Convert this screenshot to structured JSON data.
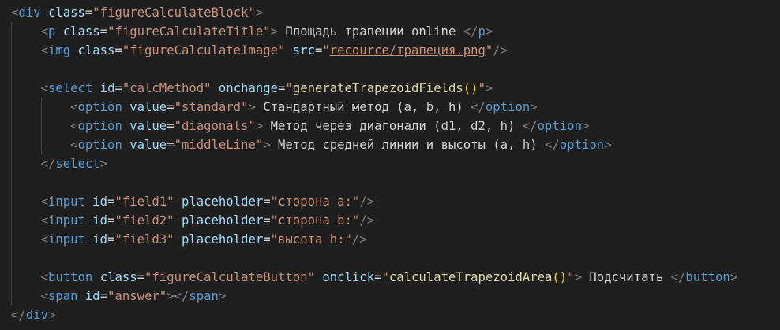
{
  "editor": {
    "lines": [
      {
        "indent": "",
        "parts": [
          {
            "c": "br",
            "t": "<"
          },
          {
            "c": "tag",
            "t": "div"
          },
          {
            "c": "txt",
            "t": " "
          },
          {
            "c": "attr",
            "t": "class"
          },
          {
            "c": "eq",
            "t": "="
          },
          {
            "c": "str",
            "t": "\"figureCalculateBlock\""
          },
          {
            "c": "br",
            "t": ">"
          }
        ]
      },
      {
        "indent": "    ",
        "parts": [
          {
            "c": "br",
            "t": "<"
          },
          {
            "c": "tag",
            "t": "p"
          },
          {
            "c": "txt",
            "t": " "
          },
          {
            "c": "attr",
            "t": "class"
          },
          {
            "c": "eq",
            "t": "="
          },
          {
            "c": "str",
            "t": "\"figureCalculateTitle\""
          },
          {
            "c": "br",
            "t": ">"
          },
          {
            "c": "txt",
            "t": " Площадь трапеции online "
          },
          {
            "c": "br",
            "t": "</"
          },
          {
            "c": "tag",
            "t": "p"
          },
          {
            "c": "br",
            "t": ">"
          }
        ]
      },
      {
        "indent": "    ",
        "parts": [
          {
            "c": "br",
            "t": "<"
          },
          {
            "c": "tag",
            "t": "img"
          },
          {
            "c": "txt",
            "t": " "
          },
          {
            "c": "attr",
            "t": "class"
          },
          {
            "c": "eq",
            "t": "="
          },
          {
            "c": "str",
            "t": "\"figureCalculateImage\""
          },
          {
            "c": "txt",
            "t": " "
          },
          {
            "c": "attr",
            "t": "src"
          },
          {
            "c": "eq",
            "t": "="
          },
          {
            "c": "str",
            "t": "\""
          },
          {
            "c": "link",
            "t": "recource/трапеция.png"
          },
          {
            "c": "str",
            "t": "\""
          },
          {
            "c": "br",
            "t": "/>"
          }
        ]
      },
      {
        "indent": "",
        "parts": []
      },
      {
        "indent": "    ",
        "parts": [
          {
            "c": "br",
            "t": "<"
          },
          {
            "c": "tag",
            "t": "select"
          },
          {
            "c": "txt",
            "t": " "
          },
          {
            "c": "attr",
            "t": "id"
          },
          {
            "c": "eq",
            "t": "="
          },
          {
            "c": "str",
            "t": "\"calcMethod\""
          },
          {
            "c": "txt",
            "t": " "
          },
          {
            "c": "attr",
            "t": "onchange"
          },
          {
            "c": "eq",
            "t": "="
          },
          {
            "c": "str",
            "t": "\""
          },
          {
            "c": "fn",
            "t": "generateTrapezoidFields"
          },
          {
            "c": "paren",
            "t": "()"
          },
          {
            "c": "str",
            "t": "\""
          },
          {
            "c": "br",
            "t": ">"
          }
        ]
      },
      {
        "indent": "        ",
        "parts": [
          {
            "c": "br",
            "t": "<"
          },
          {
            "c": "tag",
            "t": "option"
          },
          {
            "c": "txt",
            "t": " "
          },
          {
            "c": "attr",
            "t": "value"
          },
          {
            "c": "eq",
            "t": "="
          },
          {
            "c": "str",
            "t": "\"standard\""
          },
          {
            "c": "br",
            "t": ">"
          },
          {
            "c": "txt",
            "t": " Стандартный метод (a, b, h) "
          },
          {
            "c": "br",
            "t": "</"
          },
          {
            "c": "tag",
            "t": "option"
          },
          {
            "c": "br",
            "t": ">"
          }
        ]
      },
      {
        "indent": "        ",
        "parts": [
          {
            "c": "br",
            "t": "<"
          },
          {
            "c": "tag",
            "t": "option"
          },
          {
            "c": "txt",
            "t": " "
          },
          {
            "c": "attr",
            "t": "value"
          },
          {
            "c": "eq",
            "t": "="
          },
          {
            "c": "str",
            "t": "\"diagonals\""
          },
          {
            "c": "br",
            "t": ">"
          },
          {
            "c": "txt",
            "t": " Метод через диагонали (d1, d2, h) "
          },
          {
            "c": "br",
            "t": "</"
          },
          {
            "c": "tag",
            "t": "option"
          },
          {
            "c": "br",
            "t": ">"
          }
        ]
      },
      {
        "indent": "        ",
        "parts": [
          {
            "c": "br",
            "t": "<"
          },
          {
            "c": "tag",
            "t": "option"
          },
          {
            "c": "txt",
            "t": " "
          },
          {
            "c": "attr",
            "t": "value"
          },
          {
            "c": "eq",
            "t": "="
          },
          {
            "c": "str",
            "t": "\"middleLine\""
          },
          {
            "c": "br",
            "t": ">"
          },
          {
            "c": "txt",
            "t": " Метод средней линии и высоты (a, h) "
          },
          {
            "c": "br",
            "t": "</"
          },
          {
            "c": "tag",
            "t": "option"
          },
          {
            "c": "br",
            "t": ">"
          }
        ]
      },
      {
        "indent": "    ",
        "parts": [
          {
            "c": "br",
            "t": "</"
          },
          {
            "c": "tag",
            "t": "select"
          },
          {
            "c": "br",
            "t": ">"
          }
        ]
      },
      {
        "indent": "",
        "parts": []
      },
      {
        "indent": "    ",
        "parts": [
          {
            "c": "br",
            "t": "<"
          },
          {
            "c": "tag",
            "t": "input"
          },
          {
            "c": "txt",
            "t": " "
          },
          {
            "c": "attr",
            "t": "id"
          },
          {
            "c": "eq",
            "t": "="
          },
          {
            "c": "str",
            "t": "\"field1\""
          },
          {
            "c": "txt",
            "t": " "
          },
          {
            "c": "attr",
            "t": "placeholder"
          },
          {
            "c": "eq",
            "t": "="
          },
          {
            "c": "str",
            "t": "\"сторона a:\""
          },
          {
            "c": "br",
            "t": "/>"
          }
        ]
      },
      {
        "indent": "    ",
        "parts": [
          {
            "c": "br",
            "t": "<"
          },
          {
            "c": "tag",
            "t": "input"
          },
          {
            "c": "txt",
            "t": " "
          },
          {
            "c": "attr",
            "t": "id"
          },
          {
            "c": "eq",
            "t": "="
          },
          {
            "c": "str",
            "t": "\"field2\""
          },
          {
            "c": "txt",
            "t": " "
          },
          {
            "c": "attr",
            "t": "placeholder"
          },
          {
            "c": "eq",
            "t": "="
          },
          {
            "c": "str",
            "t": "\"сторона b:\""
          },
          {
            "c": "br",
            "t": "/>"
          }
        ]
      },
      {
        "indent": "    ",
        "parts": [
          {
            "c": "br",
            "t": "<"
          },
          {
            "c": "tag",
            "t": "input"
          },
          {
            "c": "txt",
            "t": " "
          },
          {
            "c": "attr",
            "t": "id"
          },
          {
            "c": "eq",
            "t": "="
          },
          {
            "c": "str",
            "t": "\"field3\""
          },
          {
            "c": "txt",
            "t": " "
          },
          {
            "c": "attr",
            "t": "placeholder"
          },
          {
            "c": "eq",
            "t": "="
          },
          {
            "c": "str",
            "t": "\"высота h:\""
          },
          {
            "c": "br",
            "t": "/>"
          }
        ]
      },
      {
        "indent": "",
        "parts": []
      },
      {
        "indent": "    ",
        "parts": [
          {
            "c": "br",
            "t": "<"
          },
          {
            "c": "tag",
            "t": "button"
          },
          {
            "c": "txt",
            "t": " "
          },
          {
            "c": "attr",
            "t": "class"
          },
          {
            "c": "eq",
            "t": "="
          },
          {
            "c": "str",
            "t": "\"figureCalculateButton\""
          },
          {
            "c": "txt",
            "t": " "
          },
          {
            "c": "attr",
            "t": "onclick"
          },
          {
            "c": "eq",
            "t": "="
          },
          {
            "c": "str",
            "t": "\""
          },
          {
            "c": "fn",
            "t": "calculateTrapezoidArea"
          },
          {
            "c": "paren",
            "t": "()"
          },
          {
            "c": "str",
            "t": "\""
          },
          {
            "c": "br",
            "t": ">"
          },
          {
            "c": "txt",
            "t": " Подсчитать "
          },
          {
            "c": "br",
            "t": "</"
          },
          {
            "c": "tag",
            "t": "button"
          },
          {
            "c": "br",
            "t": ">"
          }
        ]
      },
      {
        "indent": "    ",
        "parts": [
          {
            "c": "br",
            "t": "<"
          },
          {
            "c": "tag",
            "t": "span"
          },
          {
            "c": "txt",
            "t": " "
          },
          {
            "c": "attr",
            "t": "id"
          },
          {
            "c": "eq",
            "t": "="
          },
          {
            "c": "str",
            "t": "\"answer\""
          },
          {
            "c": "br",
            "t": "></"
          },
          {
            "c": "tag",
            "t": "span"
          },
          {
            "c": "br",
            "t": ">"
          }
        ]
      },
      {
        "indent": "",
        "parts": [
          {
            "c": "br",
            "t": "</"
          },
          {
            "c": "tag",
            "t": "div"
          },
          {
            "c": "br",
            "t": ">"
          }
        ]
      }
    ]
  },
  "colors": {
    "background": "#1f1f1f",
    "tag": "#569cd6",
    "bracket": "#808080",
    "attribute": "#9cdcfe",
    "string": "#ce9178",
    "function": "#dcdcaa",
    "paren": "#ffd700",
    "text": "#d4d4d4"
  }
}
